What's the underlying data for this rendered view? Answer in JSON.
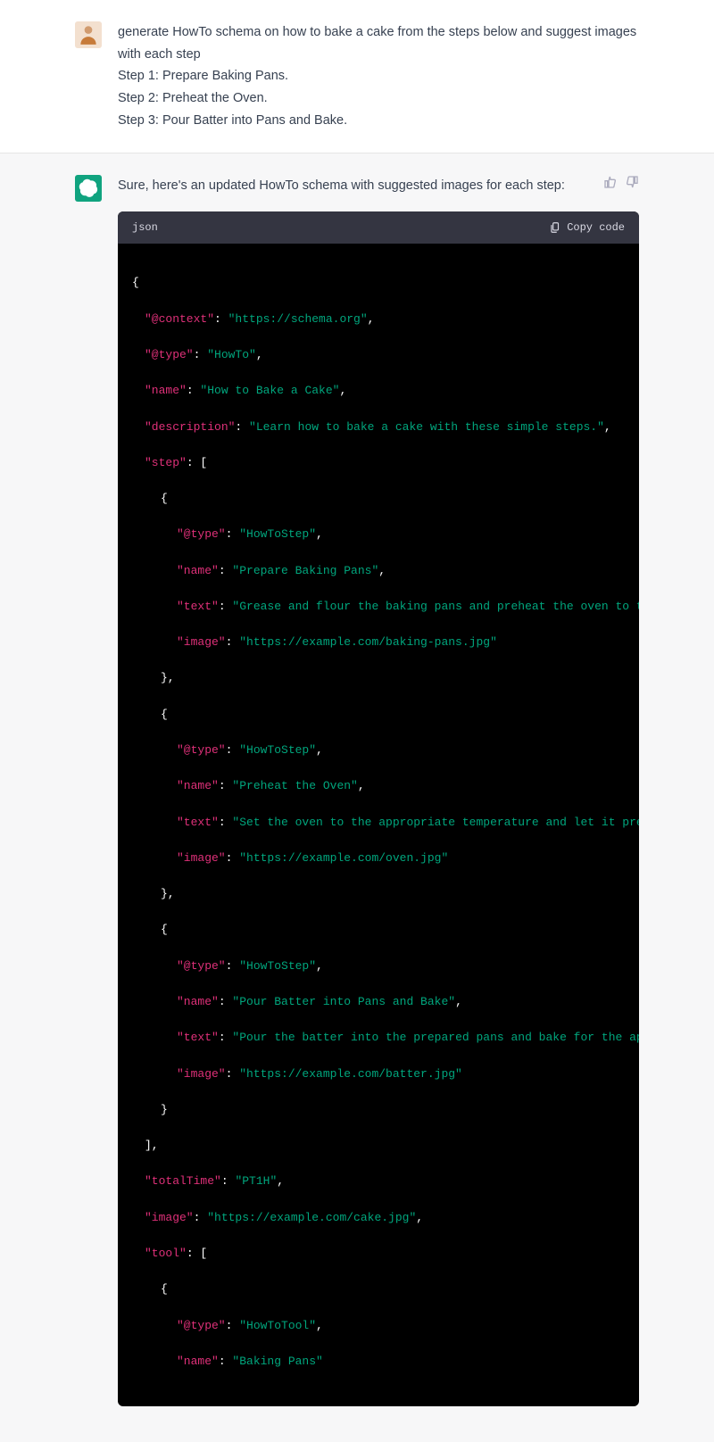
{
  "user": {
    "l1": "generate HowTo schema on how to bake a cake from the steps below and suggest images",
    "l2": "with each step",
    "l3": "Step 1: Prepare Baking Pans.",
    "l4": "Step 2: Preheat the Oven.",
    "l5": "Step 3: Pour Batter into Pans and Bake."
  },
  "assistant": {
    "intro": "Sure, here's an updated HowTo schema with suggested images for each step:"
  },
  "code": {
    "lang": "json",
    "copy": "Copy code",
    "keys": {
      "context": "\"@context\"",
      "type": "\"@type\"",
      "name": "\"name\"",
      "description": "\"description\"",
      "step": "\"step\"",
      "text": "\"text\"",
      "image": "\"image\"",
      "totalTime": "\"totalTime\"",
      "tool": "\"tool\""
    },
    "vals": {
      "contextV": "\"https://schema.org\"",
      "typeHowTo": "\"HowTo\"",
      "nameCake": "\"How to Bake a Cake\"",
      "descV": "\"Learn how to bake a cake with these simple steps.\"",
      "typeStep": "\"HowToStep\"",
      "s1name": "\"Prepare Baking Pans\"",
      "s1text": "\"Grease and flour the baking pans and preheat the oven to the appropr",
      "s1img": "\"https://example.com/baking-pans.jpg\"",
      "s2name": "\"Preheat the Oven\"",
      "s2text": "\"Set the oven to the appropriate temperature and let it preheat while",
      "s2img": "\"https://example.com/oven.jpg\"",
      "s3name": "\"Pour Batter into Pans and Bake\"",
      "s3text": "\"Pour the batter into the prepared pans and bake for the appropriate ",
      "s3img": "\"https://example.com/batter.jpg\"",
      "totalTimeV": "\"PT1H\"",
      "imageV": "\"https://example.com/cake.jpg\"",
      "typeTool": "\"HowToTool\"",
      "toolName": "\"Baking Pans\""
    },
    "punct": {
      "openBrace": "{",
      "closeBrace": "}",
      "closeBraceComma": "},",
      "openArr": "[",
      "closeArrComma": "],",
      "colon": ": ",
      "comma": ","
    }
  }
}
